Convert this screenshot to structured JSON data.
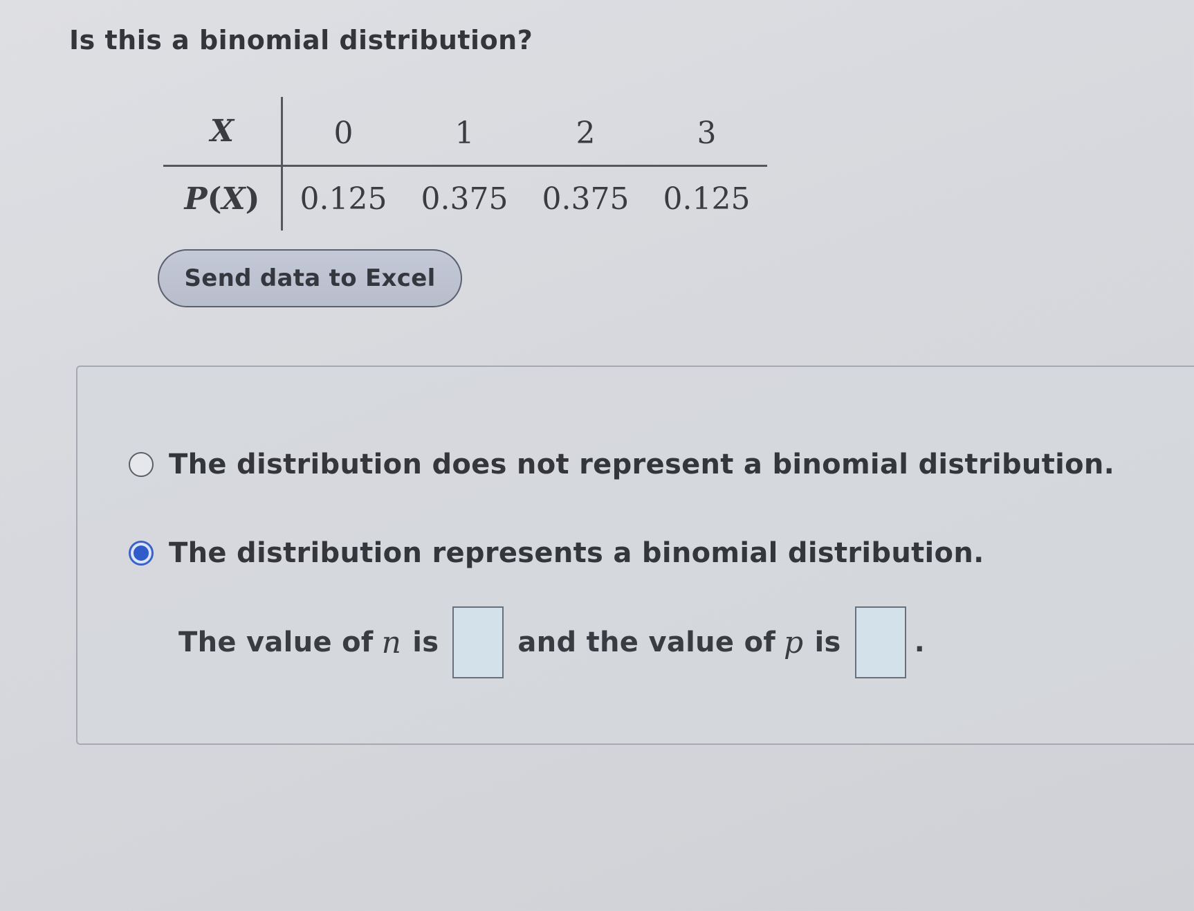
{
  "question": "Is this a binomial distribution?",
  "table": {
    "row_x": {
      "label": "X",
      "values": [
        "0",
        "1",
        "2",
        "3"
      ]
    },
    "row_p": {
      "label_p": "P",
      "label_open": "(",
      "label_x": "X",
      "label_close": ")",
      "values": [
        "0.125",
        "0.375",
        "0.375",
        "0.125"
      ]
    }
  },
  "excel_button": "Send data to Excel",
  "options": [
    {
      "label": "The distribution does not represent a binomial distribution.",
      "selected": false
    },
    {
      "label": "The distribution represents a binomial distribution.",
      "selected": true
    }
  ],
  "sentence": {
    "part1": "The value of",
    "var_n": "n",
    "part2": "is",
    "part3": "and the value of",
    "var_p": "p",
    "part4": "is",
    "end": ".",
    "n_value": "",
    "p_value": ""
  }
}
